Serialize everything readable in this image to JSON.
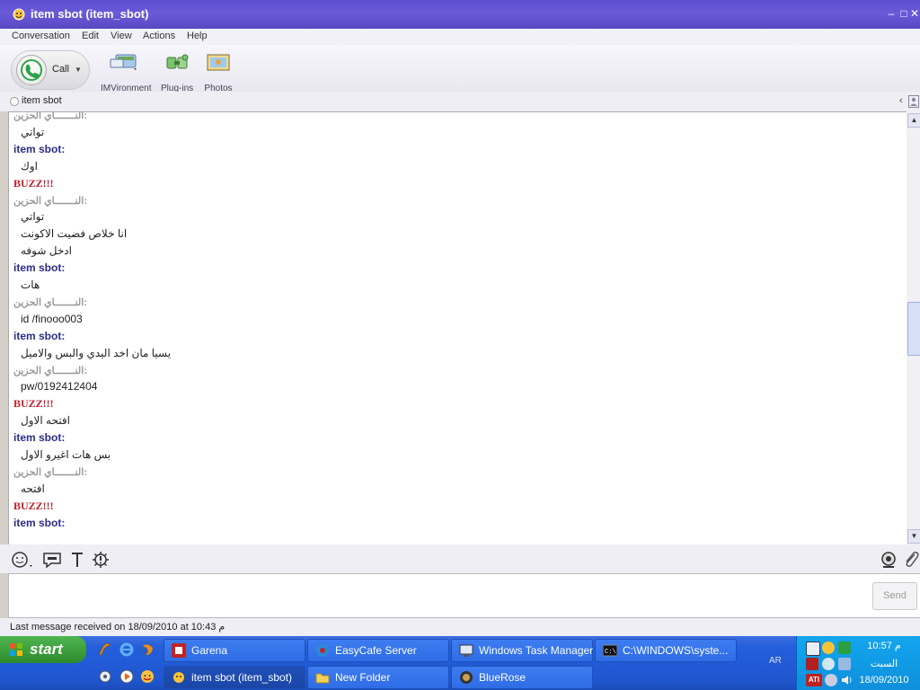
{
  "window": {
    "title": "item sbot (item_sbot)"
  },
  "menu": [
    "Conversation",
    "Edit",
    "View",
    "Actions",
    "Help"
  ],
  "toolbar": {
    "call_label": "Call",
    "imvironment_label": "IMVironment",
    "plugins_label": "Plug-ins",
    "photos_label": "Photos"
  },
  "contact": {
    "name": "item sbot"
  },
  "conversation": [
    {
      "kind": "other",
      "text": "النـــــــاي الحزين:"
    },
    {
      "kind": "text",
      "text": "تواتي"
    },
    {
      "kind": "self",
      "text": "item sbot:"
    },
    {
      "kind": "text",
      "text": "اوك"
    },
    {
      "kind": "buzz",
      "text": "BUZZ!!!"
    },
    {
      "kind": "other",
      "text": "النـــــــاي الحزين:"
    },
    {
      "kind": "text",
      "text": "تواتي"
    },
    {
      "kind": "text",
      "text": "انا خلاص فضيت الاكونت"
    },
    {
      "kind": "text",
      "text": "ادخل شوفه"
    },
    {
      "kind": "self",
      "text": "item sbot:"
    },
    {
      "kind": "text",
      "text": "هات"
    },
    {
      "kind": "other",
      "text": "النـــــــاي الحزين:"
    },
    {
      "kind": "text",
      "text": "id /finooo003"
    },
    {
      "kind": "self",
      "text": "item sbot:"
    },
    {
      "kind": "text",
      "text": "يسيا مان اخد اليدي والبس والاميل"
    },
    {
      "kind": "other",
      "text": "النـــــــاي الحزين:"
    },
    {
      "kind": "text",
      "text": "pw/0192412404"
    },
    {
      "kind": "buzz",
      "text": "BUZZ!!!"
    },
    {
      "kind": "text",
      "text": "افتحه الاول"
    },
    {
      "kind": "self",
      "text": "item sbot:"
    },
    {
      "kind": "text",
      "text": "بس هات اغيرو الاول"
    },
    {
      "kind": "other",
      "text": "النـــــــاي الحزين:"
    },
    {
      "kind": "text",
      "text": "افتحه"
    },
    {
      "kind": "buzz",
      "text": "BUZZ!!!"
    },
    {
      "kind": "self",
      "text": "item sbot:"
    }
  ],
  "input": {
    "send_label": "Send"
  },
  "status": {
    "text": "Last message received on 18/09/2010 at 10:43 م"
  },
  "taskbar": {
    "start_label": "start",
    "tasks_row1": [
      "Garena",
      "EasyCafe Server",
      "Windows Task Manager",
      "C:\\WINDOWS\\syste..."
    ],
    "tasks_row2": [
      "item sbot (item_sbot)",
      "New Folder",
      "BlueRose"
    ],
    "lang": "AR",
    "time": "10:57 م",
    "day": "السبت",
    "date": "18/09/2010"
  },
  "colors": {
    "self_sender": "#2b2d8a",
    "other_sender": "#9a9a9a",
    "buzz": "#c0202b"
  }
}
